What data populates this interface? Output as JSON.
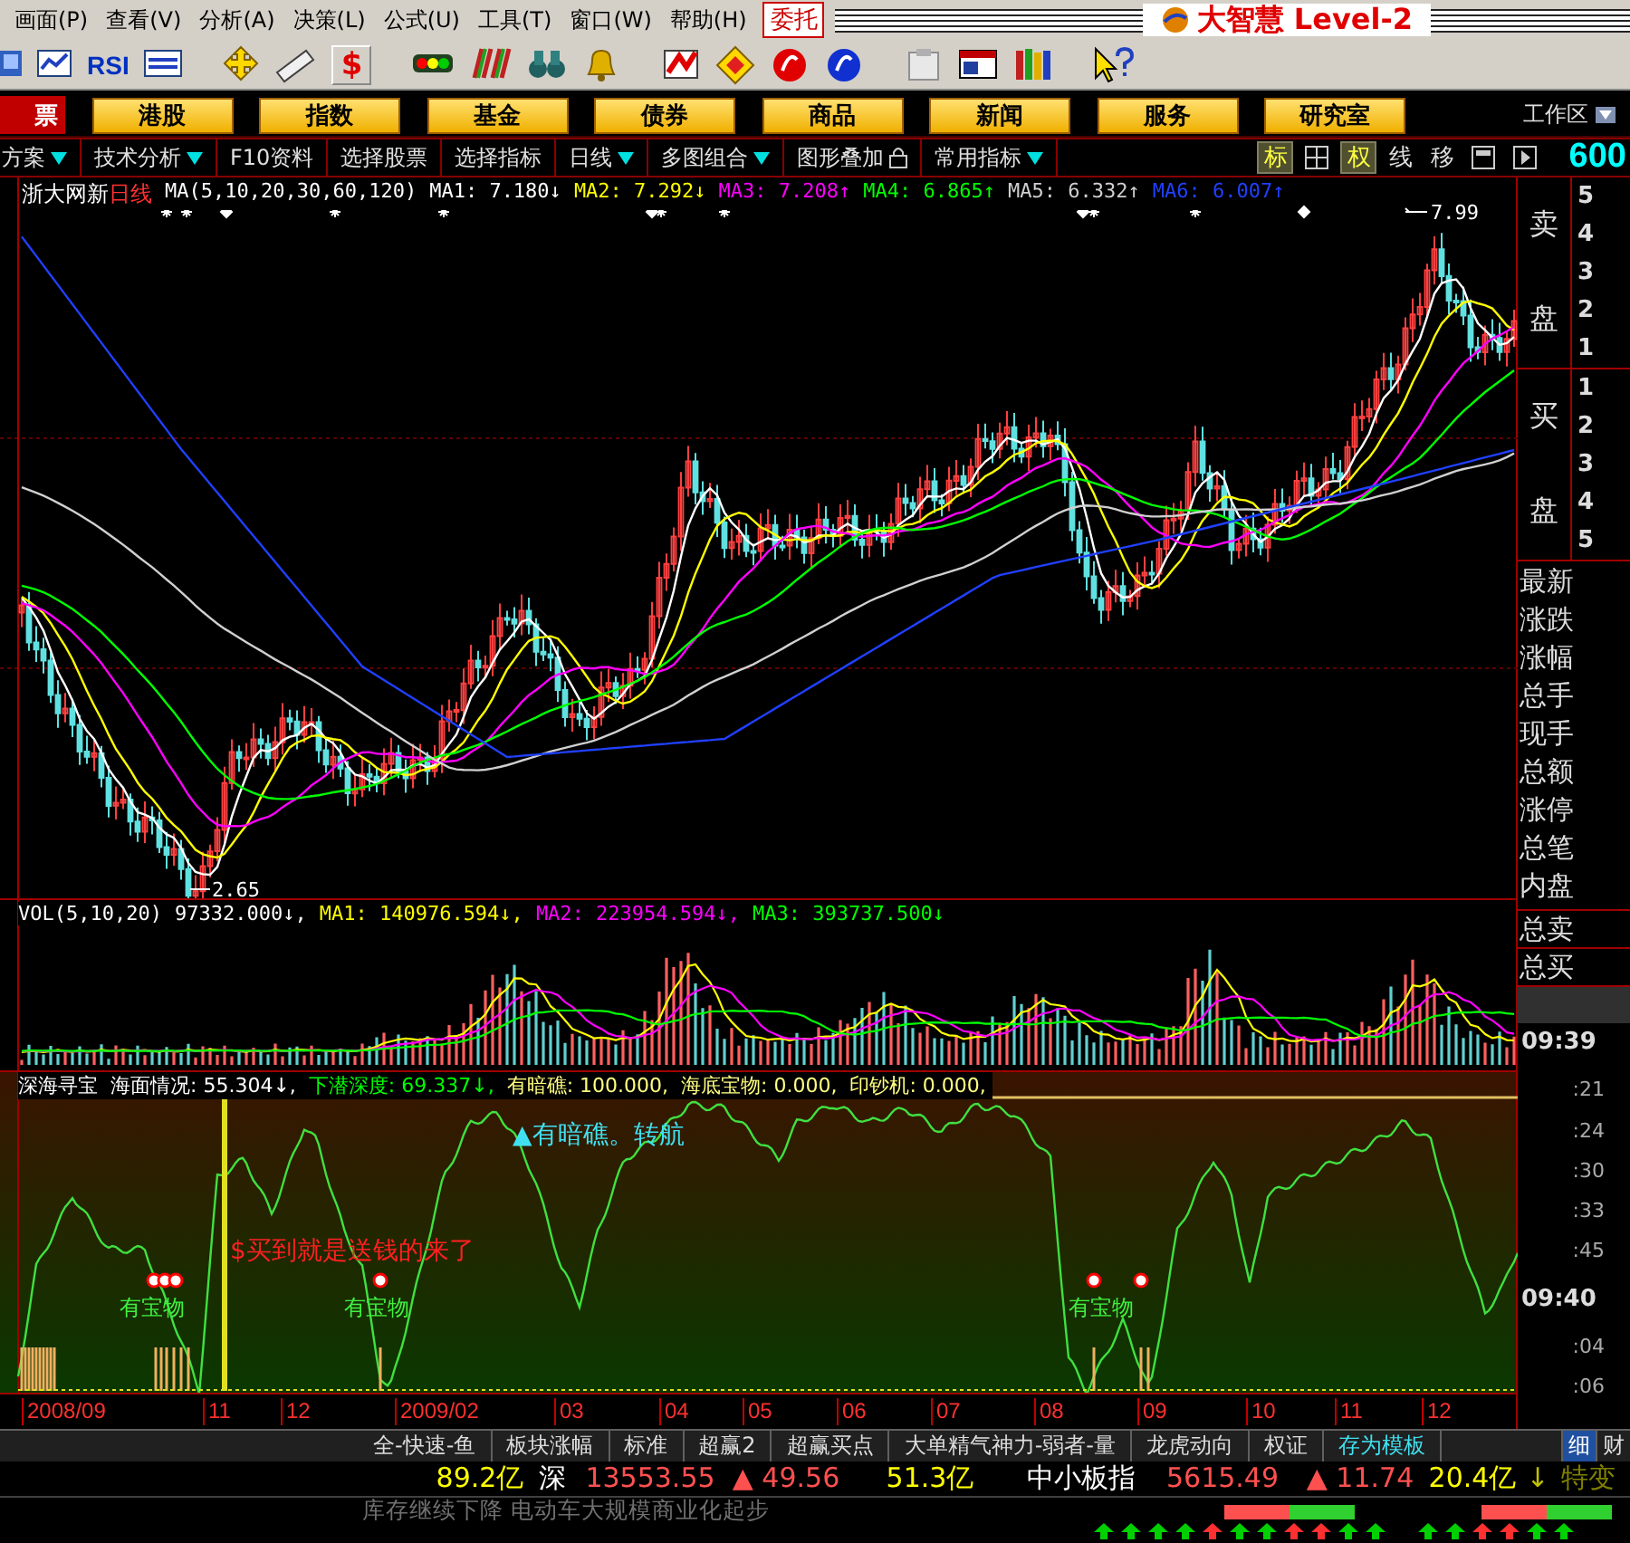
{
  "menu": {
    "items": [
      "画面(P)",
      "查看(V)",
      "分析(A)",
      "决策(L)",
      "公式(U)",
      "工具(T)",
      "窗口(W)",
      "帮助(H)"
    ],
    "trade_button": "委托",
    "logo": "大智慧 Level-2"
  },
  "toolbar": {
    "texts": [
      "RSI",
      "$"
    ]
  },
  "nav": {
    "cut_button": "票",
    "buttons": [
      "港股",
      "指数",
      "基金",
      "债券",
      "商品",
      "新闻",
      "服务",
      "研究室"
    ],
    "workspace": "工作区"
  },
  "subbar": {
    "items": [
      {
        "label": "方案",
        "kind": "dropdown"
      },
      {
        "label": "技术分析",
        "kind": "dropdown"
      },
      {
        "label": "F10资料",
        "kind": "plain"
      },
      {
        "label": "选择股票",
        "kind": "plain"
      },
      {
        "label": "选择指标",
        "kind": "plain"
      },
      {
        "label": "日线",
        "kind": "dropdown"
      },
      {
        "label": "多图组合",
        "kind": "dropdown"
      },
      {
        "label": "图形叠加",
        "kind": "lock"
      },
      {
        "label": "常用指标",
        "kind": "dropdown"
      }
    ],
    "view_buttons": [
      {
        "kind": "text",
        "label": "标",
        "selected": true
      },
      {
        "kind": "grid"
      },
      {
        "kind": "text",
        "label": "权",
        "selected": true
      },
      {
        "kind": "text",
        "label": "线",
        "selected": false
      },
      {
        "kind": "text",
        "label": "移",
        "selected": false
      },
      {
        "kind": "frame"
      },
      {
        "kind": "play"
      }
    ],
    "code": "600"
  },
  "price_chart": {
    "stock": "浙大网新",
    "period": "日线",
    "ma_title": "MA(5,10,20,30,60,120)",
    "ma": [
      {
        "label": "MA1: 7.180↓",
        "color": "#ffffff"
      },
      {
        "label": "MA2: 7.292↓",
        "color": "#ffff00"
      },
      {
        "label": "MA3: 7.208↑",
        "color": "#ff00ff"
      },
      {
        "label": "MA4: 6.865↑",
        "color": "#00ff00"
      },
      {
        "label": "MA5: 6.332↑",
        "color": "#d0d0d0"
      },
      {
        "label": "MA6: 6.007↑",
        "color": "#2040ff"
      }
    ],
    "high_label": "7.99",
    "low_label": "2.65"
  },
  "volume_chart": {
    "title": "VOL(5,10,20)",
    "values": [
      {
        "label": "97332.000↓,"
      },
      {
        "label": "MA1: 140976.594↓,",
        "color": "#ffff00"
      },
      {
        "label": "MA2: 223954.594↓,",
        "color": "#ff00ff"
      },
      {
        "label": "MA3: 393737.500↓",
        "color": "#00ff00"
      }
    ]
  },
  "indicator": {
    "name": "深海寻宝",
    "values": [
      {
        "label": "海面情况: 55.304↓,",
        "kind": "surface"
      },
      {
        "label": "下潜深度: 69.337↓,",
        "kind": "depth"
      },
      {
        "label": "有暗礁: 100.000,",
        "kind": "signal"
      },
      {
        "label": "海底宝物: 0.000,",
        "kind": "signal"
      },
      {
        "label": "印钞机: 0.000,",
        "kind": "signal"
      }
    ],
    "annotations": [
      {
        "kind": "warning",
        "text": "▲有暗礁。转航"
      },
      {
        "kind": "buy",
        "text": "$买到就是送钱的来了"
      },
      {
        "kind": "treasure",
        "text": "有宝物"
      },
      {
        "kind": "treasure",
        "text": "有宝物"
      },
      {
        "kind": "treasure",
        "text": "有宝物"
      }
    ]
  },
  "dates": [
    "2008/09",
    "11",
    "12",
    "2009/02",
    "03",
    "04",
    "05",
    "06",
    "07",
    "08",
    "09",
    "10",
    "11",
    "12"
  ],
  "side_panel": {
    "ask": {
      "top": "卖",
      "bottom": "盘",
      "levels": [
        "5",
        "4",
        "3",
        "2",
        "1"
      ]
    },
    "bid": {
      "top": "买",
      "bottom": "盘",
      "levels": [
        "1",
        "2",
        "3",
        "4",
        "5"
      ]
    },
    "fields": [
      "最新",
      "涨跌",
      "涨幅",
      "总手",
      "现手",
      "总额",
      "涨停",
      "总笔",
      "内盘"
    ],
    "totals": [
      "总卖",
      "总买"
    ],
    "times": [
      {
        "kind": "minute",
        "text": "09:39"
      },
      {
        "kind": "second",
        "text": ":21"
      },
      {
        "kind": "second",
        "text": ":24"
      },
      {
        "kind": "second",
        "text": ":30"
      },
      {
        "kind": "second",
        "text": ":33"
      },
      {
        "kind": "second",
        "text": ":45"
      },
      {
        "kind": "minute",
        "text": "09:40"
      },
      {
        "kind": "second",
        "text": ":04"
      },
      {
        "kind": "second",
        "text": ":06"
      }
    ]
  },
  "bottom_tabs": [
    {
      "label": "全-快速-鱼",
      "kind": "tab",
      "selected": false
    },
    {
      "label": "板块涨幅",
      "kind": "tab",
      "selected": false
    },
    {
      "label": "标准",
      "kind": "tab",
      "selected": false
    },
    {
      "label": "超赢2",
      "kind": "tab",
      "selected": false
    },
    {
      "label": "超赢买点",
      "kind": "tab",
      "selected": false
    },
    {
      "label": "大单精气神力-弱者-量",
      "kind": "tab",
      "selected": false
    },
    {
      "label": "龙虎动向",
      "kind": "tab",
      "selected": false
    },
    {
      "label": "权证",
      "kind": "tab",
      "selected": false
    },
    {
      "label": "存为模板",
      "kind": "action",
      "selected": false
    }
  ],
  "side_tabs": [
    {
      "label": "细",
      "selected": true
    },
    {
      "label": "财",
      "selected": false
    }
  ],
  "status": [
    {
      "text": "89.2亿",
      "kind": "amount"
    },
    {
      "text": "深",
      "kind": "market"
    },
    {
      "text": "13553.55",
      "kind": "index"
    },
    {
      "text": "▲ 49.56",
      "kind": "change"
    },
    {
      "text": "51.3亿",
      "kind": "amount"
    },
    {
      "text": "中小板指",
      "kind": "market"
    },
    {
      "text": "5615.49",
      "kind": "index"
    },
    {
      "text": "▲ 11.74",
      "kind": "change"
    },
    {
      "text": "20.4亿",
      "kind": "amount"
    },
    {
      "text": "↓",
      "kind": "arrow"
    },
    {
      "text": "特变",
      "kind": "stock"
    }
  ],
  "ticker": {
    "text": "库存继续下降 电动车大规模商业化起步",
    "arrows": [
      {
        "color": "#00d000"
      },
      {
        "color": "#00d000"
      },
      {
        "color": "#00d000"
      },
      {
        "color": "#00d000"
      },
      {
        "color": "#ff3030"
      },
      {
        "color": "#00d000"
      },
      {
        "color": "#00d000"
      },
      {
        "color": "#ff3030"
      },
      {
        "color": "#ff3030"
      },
      {
        "color": "#00d000"
      },
      {
        "color": "#00d000"
      },
      {
        "color": "#00d000"
      },
      {
        "color": "#00d000"
      },
      {
        "color": "#ff3030"
      },
      {
        "color": "#ff3030"
      },
      {
        "color": "#00d000"
      },
      {
        "color": "#00d000"
      }
    ]
  }
}
